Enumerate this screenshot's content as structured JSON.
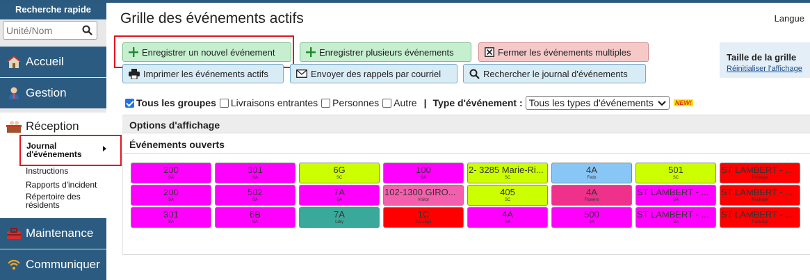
{
  "colors": {
    "magenta": "#ff00ff",
    "lime": "#ccff00",
    "red": "#ff0000",
    "skyblue": "#87c6f5",
    "pink": "#f0318c",
    "hotpink": "#f35fac",
    "teal": "#3aa89a",
    "nav_blue": "#2b5b80"
  },
  "sidebar": {
    "quick_search_title": "Recherche rapide",
    "search_placeholder": "Unité/Nom",
    "nav": {
      "accueil": "Accueil",
      "gestion": "Gestion",
      "reception": "Réception",
      "maintenance": "Maintenance",
      "communiquer": "Communiquer"
    },
    "sub": {
      "journal": "Journal d'événements",
      "instructions": "Instructions",
      "rapports": "Rapports d'incident",
      "repertoire": "Répertoire des résidents"
    }
  },
  "header": {
    "title": "Grille des événements actifs",
    "langue": "Langue"
  },
  "toolbar": {
    "new_event": "Enregistrer un nouvel événement",
    "multi_event": "Enregistrer plusieurs événements",
    "close_multi": "Fermer les événements multiples",
    "print": "Imprimer les événements actifs",
    "reminders": "Envoyer des rappels par courriel",
    "search_log": "Rechercher le journal d'événements"
  },
  "size_panel": {
    "title": "Taille de la grille",
    "reset": "Réinitialiser l'affichage"
  },
  "filters": {
    "all_groups": "Tous les groupes",
    "incoming": "Livraisons entrantes",
    "persons": "Personnes",
    "other": "Autre",
    "separator": "|",
    "type_label": "Type d'événement :",
    "type_value": "Tous les types d'événements",
    "new_badge": "NEW!"
  },
  "sections": {
    "display_options": "Options d'affichage",
    "open_events": "Événements ouverts"
  },
  "grid": [
    [
      {
        "main": "200",
        "sub": "SA",
        "color": "magenta"
      },
      {
        "main": "301",
        "sub": "SA",
        "color": "magenta"
      },
      {
        "main": "6G",
        "sub": "SC",
        "color": "lime"
      },
      {
        "main": "100",
        "sub": "SA",
        "color": "magenta"
      },
      {
        "main": "2- 3285 Marie-Ri...",
        "sub": "SC",
        "color": "lime"
      },
      {
        "main": "4A",
        "sub": "Fedx",
        "color": "skyblue"
      },
      {
        "main": "501",
        "sub": "SC",
        "color": "lime"
      },
      {
        "main": "ST LAMBERT - ...",
        "sub": "Package",
        "color": "red"
      }
    ],
    [
      {
        "main": "200",
        "sub": "SA",
        "color": "magenta"
      },
      {
        "main": "502",
        "sub": "SA",
        "color": "magenta"
      },
      {
        "main": "7A",
        "sub": "SA",
        "color": "magenta"
      },
      {
        "main": "102-1300 GIRO...",
        "sub": "Visitor",
        "color": "hotpink"
      },
      {
        "main": "405",
        "sub": "SC",
        "color": "lime"
      },
      {
        "main": "4A",
        "sub": "Flowers",
        "color": "pink"
      },
      {
        "main": "ST LAMBERT - ...",
        "sub": "SA",
        "color": "magenta"
      },
      {
        "main": "ST LAMBERT - ...",
        "sub": "Package",
        "color": "red"
      }
    ],
    [
      {
        "main": "301",
        "sub": "SA",
        "color": "magenta"
      },
      {
        "main": "6B",
        "sub": "SA",
        "color": "magenta"
      },
      {
        "main": "7A",
        "sub": "Ldry",
        "color": "teal"
      },
      {
        "main": "1C",
        "sub": "Package",
        "color": "red"
      },
      {
        "main": "4A",
        "sub": "SA",
        "color": "magenta"
      },
      {
        "main": "500",
        "sub": "SA",
        "color": "magenta"
      },
      {
        "main": "ST LAMBERT - ...",
        "sub": "SA",
        "color": "magenta"
      },
      {
        "main": "ST LAMBERT - ...",
        "sub": "Package",
        "color": "red"
      }
    ]
  ]
}
